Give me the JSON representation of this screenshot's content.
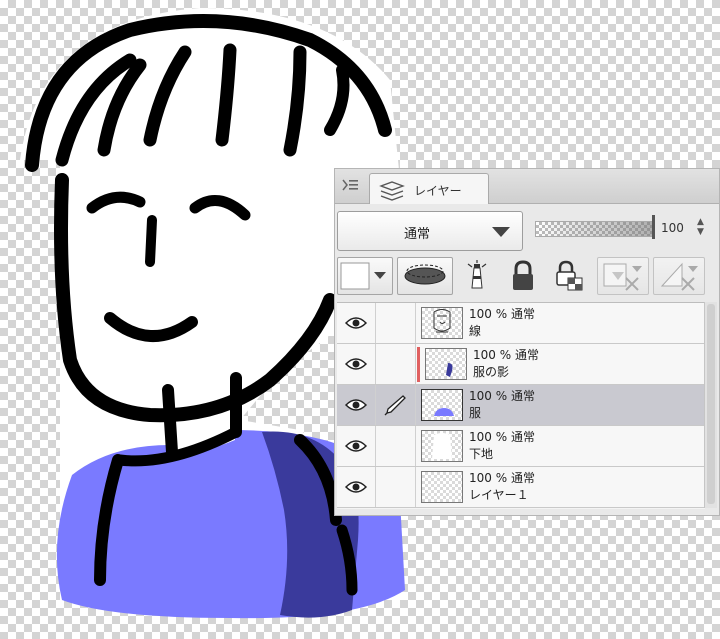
{
  "panel": {
    "tab_label": "レイヤー",
    "blend_mode": "通常",
    "opacity": "100",
    "opacity_fraction": 1.0
  },
  "layers": [
    {
      "opacity": "100",
      "unit": "%",
      "mode": "通常",
      "name": "線",
      "visible": true,
      "selected": false,
      "clipped": false
    },
    {
      "opacity": "100",
      "unit": "%",
      "mode": "通常",
      "name": "服の影",
      "visible": true,
      "selected": false,
      "clipped": true
    },
    {
      "opacity": "100",
      "unit": "%",
      "mode": "通常",
      "name": "服",
      "visible": true,
      "selected": true,
      "clipped": false
    },
    {
      "opacity": "100",
      "unit": "%",
      "mode": "通常",
      "name": "下地",
      "visible": true,
      "selected": false,
      "clipped": false
    },
    {
      "opacity": "100",
      "unit": "%",
      "mode": "通常",
      "name": "レイヤー１",
      "visible": true,
      "selected": false,
      "clipped": false
    }
  ],
  "icons": {
    "tab": "layers-stack-icon",
    "eye": "eye-icon",
    "pen": "pen-icon",
    "palette": "layer-color-icon",
    "clip": "clip-to-layer-icon",
    "reference": "reference-layer-icon",
    "lock": "lock-icon",
    "lock_alpha": "lock-transparent-icon",
    "mask_enable": "layer-mask-icon",
    "ruler_disable": "ruler-icon"
  },
  "colors": {
    "shirt": "#7a7aff",
    "shirt_shadow": "#3a3a9c",
    "clip_bar": "#e06060",
    "selected_row": "#c9c9d0"
  }
}
